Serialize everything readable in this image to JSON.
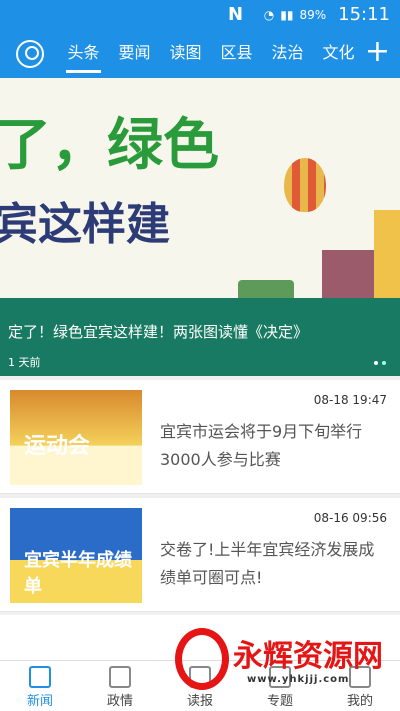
{
  "status": {
    "battery": "89%",
    "time": "15:11",
    "signal": "N"
  },
  "tabs": [
    "头条",
    "要闻",
    "读图",
    "区县",
    "法治",
    "文化"
  ],
  "hero": {
    "headline": "定了！绿色宜宾这样建！两张图读懂《决定》",
    "time": "1 天前",
    "image_text_1": "了，绿色",
    "image_text_2": "宾这样建"
  },
  "news": [
    {
      "date": "08-18 19:47",
      "title": "宜宾市运会将于9月下旬举行3000人参与比赛",
      "thumb_text": "运动会"
    },
    {
      "date": "08-16 09:56",
      "title": "交卷了!上半年宜宾经济发展成绩单可圈可点!",
      "thumb_text": "宜宾半年成绩单"
    }
  ],
  "bottom_nav": [
    "新闻",
    "政情",
    "读报",
    "专题",
    "我的"
  ],
  "watermark": {
    "name": "永辉资源网",
    "url": "www.yhkjjj.com"
  }
}
